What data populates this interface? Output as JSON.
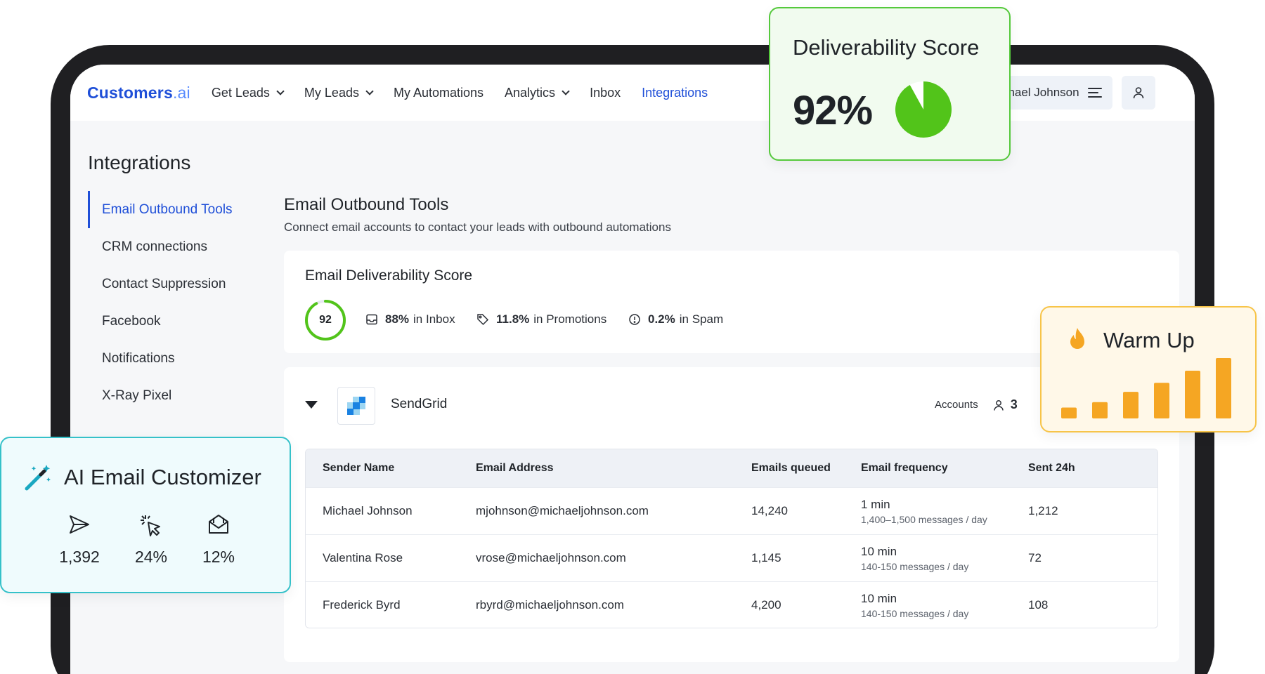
{
  "app": {
    "logo_main": "Customers",
    "logo_suffix": ".ai"
  },
  "nav": {
    "items": [
      {
        "label": "Get Leads",
        "dropdown": true
      },
      {
        "label": "My Leads",
        "dropdown": true
      },
      {
        "label": "My Automations",
        "dropdown": false
      },
      {
        "label": "Analytics",
        "dropdown": true
      },
      {
        "label": "Inbox",
        "dropdown": false
      },
      {
        "label": "Integrations",
        "dropdown": false,
        "active": true
      }
    ],
    "user_name": "Michael Johnson"
  },
  "sidebar": {
    "title": "Integrations",
    "items": [
      {
        "label": "Email Outbound Tools",
        "active": true
      },
      {
        "label": "CRM connections"
      },
      {
        "label": "Contact Suppression"
      },
      {
        "label": "Facebook"
      },
      {
        "label": "Notifications"
      },
      {
        "label": "X-Ray Pixel"
      }
    ]
  },
  "main": {
    "title": "Email Outbound Tools",
    "subtitle": "Connect email accounts to contact your leads with outbound automations",
    "score_card": {
      "title": "Email Deliverability Score",
      "score": "92",
      "score_fraction": 0.92,
      "inbox_value": "88%",
      "inbox_label": "in Inbox",
      "promotions_value": "11.8%",
      "promotions_label": "in Promotions",
      "spam_value": "0.2%",
      "spam_label": "in Spam"
    },
    "provider": {
      "name": "SendGrid",
      "accounts_label": "Accounts",
      "accounts_count": "3"
    },
    "table": {
      "headers": [
        "Sender Name",
        "Email Address",
        "Emails queued",
        "Email frequency",
        "Sent 24h"
      ],
      "rows": [
        {
          "name": "Michael Johnson",
          "email": "mjohnson@michaeljohnson.com",
          "queued": "14,240",
          "freq": "1 min",
          "freq_detail": "1,400–1,500 messages / day",
          "sent": "1,212"
        },
        {
          "name": "Valentina Rose",
          "email": "vrose@michaeljohnson.com",
          "queued": "1,145",
          "freq": "10 min",
          "freq_detail": "140-150 messages / day",
          "sent": "72"
        },
        {
          "name": "Frederick Byrd",
          "email": "rbyrd@michaeljohnson.com",
          "queued": "4,200",
          "freq": "10 min",
          "freq_detail": "140-150 messages / day",
          "sent": "108"
        }
      ]
    }
  },
  "deliverability_widget": {
    "title": "Deliverability Score",
    "value": "92%",
    "fraction": 0.92,
    "color": "#52c41a"
  },
  "warmup_widget": {
    "title": "Warm Up",
    "bar_levels": [
      0.18,
      0.27,
      0.44,
      0.59,
      0.79,
      1.0
    ],
    "color": "#f5a623"
  },
  "ai_widget": {
    "title": "AI Email Customizer",
    "stats": [
      {
        "icon": "send-icon",
        "value": "1,392"
      },
      {
        "icon": "click-icon",
        "value": "24%"
      },
      {
        "icon": "inbox-open-icon",
        "value": "12%"
      }
    ]
  },
  "colors": {
    "accent": "#1f4fd8",
    "score_green": "#52c41a",
    "warm_orange": "#f5a623",
    "ai_teal": "#1aa8c1"
  }
}
